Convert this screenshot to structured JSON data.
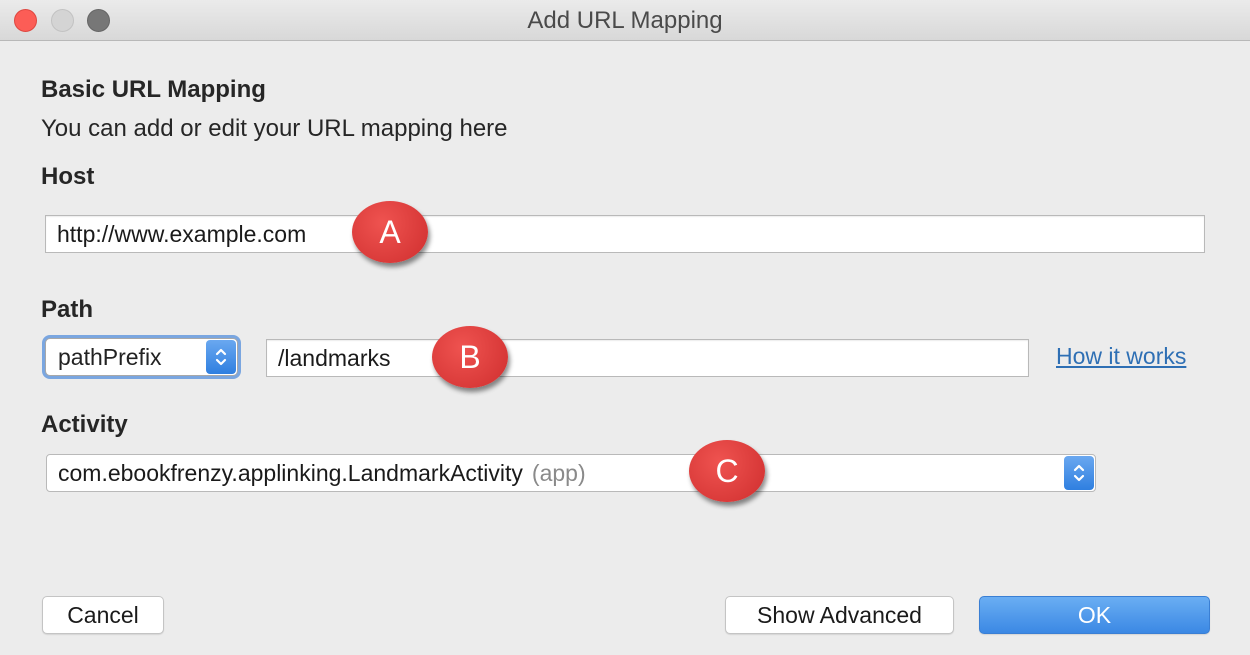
{
  "window": {
    "title": "Add URL Mapping"
  },
  "section": {
    "heading": "Basic URL Mapping",
    "description": "You can add or edit your URL mapping here"
  },
  "host": {
    "label": "Host",
    "value": "http://www.example.com"
  },
  "path": {
    "label": "Path",
    "type_selected": "pathPrefix",
    "value": "/landmarks",
    "help_link": "How it works"
  },
  "activity": {
    "label": "Activity",
    "selected": "com.ebookfrenzy.applinking.LandmarkActivity",
    "module": "(app)"
  },
  "callouts": {
    "a": "A",
    "b": "B",
    "c": "C"
  },
  "buttons": {
    "cancel": "Cancel",
    "show_advanced": "Show Advanced",
    "ok": "OK"
  },
  "colors": {
    "accent": "#3b88e4",
    "callout": "#d63a3a",
    "link": "#2e6fb4"
  }
}
